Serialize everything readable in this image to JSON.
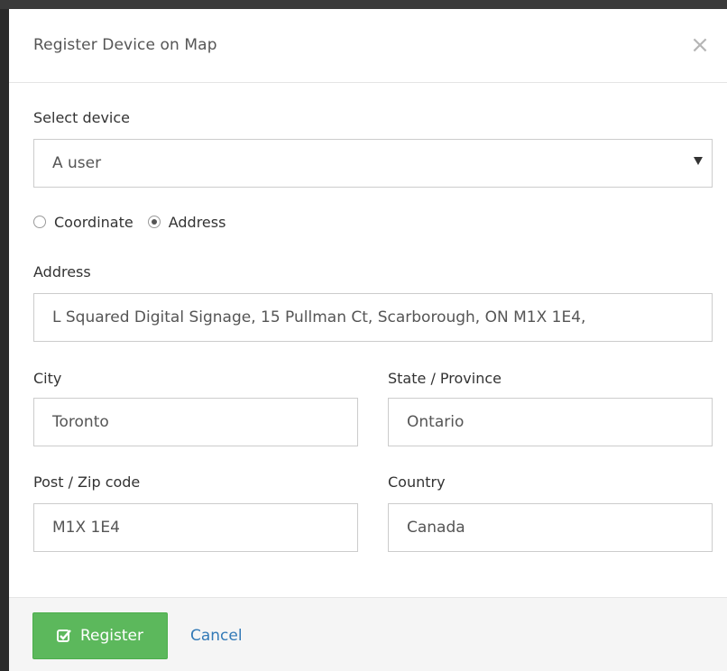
{
  "modal": {
    "title": "Register Device on Map",
    "close_symbol": "×"
  },
  "form": {
    "select_device_label": "Select device",
    "select_device_value": "A user",
    "location_mode": {
      "options": [
        "Coordinate",
        "Address"
      ],
      "selected": "Address"
    },
    "address_label": "Address",
    "address_value": "L Squared Digital Signage, 15 Pullman Ct, Scarborough, ON M1X 1E4,",
    "city_label": "City",
    "city_value": "Toronto",
    "state_label": "State / Province",
    "state_value": "Ontario",
    "zip_label": "Post / Zip code",
    "zip_value": "M1X 1E4",
    "country_label": "Country",
    "country_value": "Canada"
  },
  "footer": {
    "register_label": "Register",
    "cancel_label": "Cancel"
  },
  "colors": {
    "primary_button": "#5cb85c",
    "link": "#337ab7"
  },
  "icons": {
    "register": "check-square-icon",
    "close": "close-icon",
    "select": "caret-down-icon"
  }
}
